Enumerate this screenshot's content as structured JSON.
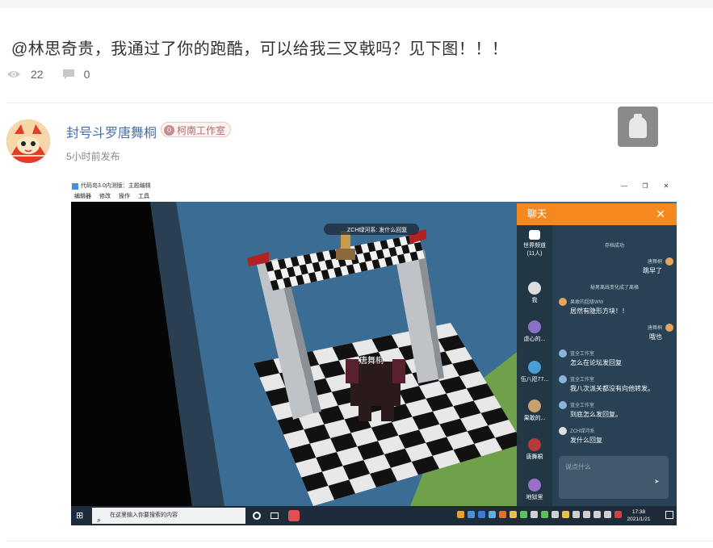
{
  "post": {
    "title": "@林思奇贵，我通过了你的跑酷，可以给我三叉戟吗？见下图！！！",
    "views": "22",
    "comments": "0"
  },
  "author": {
    "name": "封号斗罗唐舞桐",
    "badge_level": "0",
    "badge_text": "柯南工作室",
    "time": "5小时前发布"
  },
  "screenshot": {
    "window_title": "代码岛3.0内测版：主题编辑",
    "menu": [
      "编辑器",
      "修改",
      "操作",
      "工具"
    ],
    "game_label_top": "ZCH绿河系: 发什么回复",
    "player_name": "唐舞桐",
    "chat": {
      "title": "聊天",
      "close": "✕",
      "sidebar": [
        {
          "label": "世界频道",
          "sub": "(11人)"
        },
        {
          "label": "我",
          "sub": ""
        },
        {
          "label": "虐心的...",
          "sub": ""
        },
        {
          "label": "伍八咫77...",
          "sub": ""
        },
        {
          "label": "果敢的...",
          "sub": ""
        },
        {
          "label": "唐舞桐",
          "sub": ""
        },
        {
          "label": "地狱里",
          "sub": ""
        }
      ],
      "messages": [
        {
          "type": "sys",
          "text": "存档成功"
        },
        {
          "type": "right",
          "name": "唐舞桐",
          "text": "跳早了"
        },
        {
          "type": "sys",
          "text": "秘男离线变化成了离格"
        },
        {
          "type": "left",
          "name": "果敢的超级WW",
          "text": "居然有隐形方块！！"
        },
        {
          "type": "right",
          "name": "唐舞桐",
          "text": "哦也"
        },
        {
          "type": "left",
          "name": "蓝全工作室",
          "text": "怎么在论坛发回复"
        },
        {
          "type": "left",
          "name": "蓝全工作室",
          "text": "我八次派关都没有向他转发。"
        },
        {
          "type": "left",
          "name": "蓝全工作室",
          "text": "到底怎么发回复。"
        },
        {
          "type": "left",
          "name": "ZCH绿河系",
          "text": "发什么回复"
        }
      ],
      "input_placeholder": "说点什么"
    },
    "taskbar": {
      "search_placeholder": "在这里输入你要搜索的内容",
      "time": "17:38",
      "date": "2021/1/21"
    }
  },
  "colors": {
    "accent": "#f5891e",
    "username": "#4a6fa5",
    "chat_bg": "#283e4e",
    "taskbar": "#1d2b3a",
    "water": "#3a6c94"
  }
}
